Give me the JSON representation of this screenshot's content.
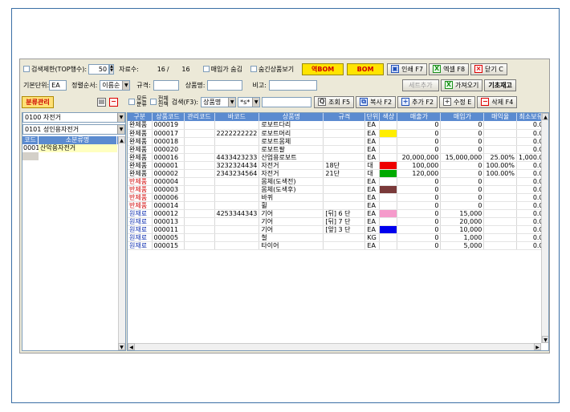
{
  "toolbar1": {
    "search_limit_label": "검색제한(TOP행수):",
    "search_limit_value": "50",
    "record_label": "자료수:",
    "record_current": "16",
    "record_sep": "/",
    "record_total": "16",
    "hide_buy_price_label": "매입가 숨김",
    "show_hidden_label": "숨긴상품보기",
    "reverse_bom_label": "역BOM",
    "bom_label": "BOM",
    "print_label": "인쇄 F7",
    "excel_label": "엑셀 F8",
    "close_label": "닫기 C"
  },
  "toolbar2": {
    "base_unit_label": "기본단위:",
    "base_unit_value": "EA",
    "sort_label": "정렬순서:",
    "sort_value": "이름순",
    "spec_label": "규격:",
    "product_name_label": "상품명:",
    "note_label": "비고:",
    "set_add_label": "세트추가",
    "import_label": "가져오기",
    "base_stock_label": "기초재고"
  },
  "toolbar3": {
    "category_mgmt_label": "분류관리",
    "all_category_label_1": "모든",
    "all_category_label_2": "분류",
    "all_period_label_1": "전체",
    "all_period_label_2": "전책",
    "search_label": "검색(F3):",
    "search_field_value": "상품명",
    "search_op_value": "*s*",
    "query_label": "조회 F5",
    "copy_label": "복사 F2",
    "add_label": "추가 F2",
    "edit_label": "수정 E",
    "delete_label": "삭제 F4"
  },
  "left": {
    "combo1": "0100 자전거",
    "combo2": "0101 성인용자전거",
    "col_code": "코드",
    "col_subcat": "소분류명",
    "rows": [
      {
        "code": "0001",
        "name": "산악용자전거"
      }
    ]
  },
  "grid": {
    "columns": [
      "구분",
      "상품코드",
      "관리코드",
      "바코드",
      "상품명",
      "규격",
      "단위",
      "색상",
      "매출가",
      "매입가",
      "매익율",
      "최소보유"
    ],
    "rows": [
      {
        "type": "완제품",
        "code": "000019",
        "mgmt": "",
        "barcode": "",
        "name": "로보트다리",
        "spec": "",
        "unit": "EA",
        "color": "",
        "sale": "0",
        "buy": "0",
        "margin": "",
        "min": "0.0"
      },
      {
        "type": "완제품",
        "code": "000017",
        "mgmt": "",
        "barcode": "2222222222",
        "name": "로보트머리",
        "spec": "",
        "unit": "EA",
        "color": "#ffee00",
        "sale": "0",
        "buy": "0",
        "margin": "",
        "min": "0.0"
      },
      {
        "type": "완제품",
        "code": "000018",
        "mgmt": "",
        "barcode": "",
        "name": "로보트몸체",
        "spec": "",
        "unit": "EA",
        "color": "",
        "sale": "0",
        "buy": "0",
        "margin": "",
        "min": "0.0"
      },
      {
        "type": "완제품",
        "code": "000020",
        "mgmt": "",
        "barcode": "",
        "name": "로보트팔",
        "spec": "",
        "unit": "EA",
        "color": "",
        "sale": "0",
        "buy": "0",
        "margin": "",
        "min": "0.0"
      },
      {
        "type": "완제품",
        "code": "000016",
        "mgmt": "",
        "barcode": "4433423233",
        "name": "산업용로보트",
        "spec": "",
        "unit": "EA",
        "color": "",
        "sale": "20,000,000",
        "buy": "15,000,000",
        "margin": "25.00%",
        "min": "1,000.0"
      },
      {
        "type": "완제품",
        "code": "000001",
        "mgmt": "",
        "barcode": "3232324434",
        "name": "자전거",
        "spec": "18단",
        "unit": "대",
        "color": "#ee0000",
        "sale": "100,000",
        "buy": "0",
        "margin": "100.00%",
        "min": "0.0"
      },
      {
        "type": "완제품",
        "code": "000002",
        "mgmt": "",
        "barcode": "2343234564",
        "name": "자전거",
        "spec": "21단",
        "unit": "대",
        "color": "#00aa00",
        "sale": "120,000",
        "buy": "0",
        "margin": "100.00%",
        "min": "0.0"
      },
      {
        "type": "반제품",
        "code": "000004",
        "mgmt": "",
        "barcode": "",
        "name": "몸체(도색전)",
        "spec": "",
        "unit": "EA",
        "color": "",
        "sale": "0",
        "buy": "0",
        "margin": "",
        "min": "0.0"
      },
      {
        "type": "반제품",
        "code": "000003",
        "mgmt": "",
        "barcode": "",
        "name": "몸체(도색후)",
        "spec": "",
        "unit": "EA",
        "color": "#7a3a3a",
        "sale": "0",
        "buy": "0",
        "margin": "",
        "min": "0.0"
      },
      {
        "type": "반제품",
        "code": "000006",
        "mgmt": "",
        "barcode": "",
        "name": "바퀴",
        "spec": "",
        "unit": "EA",
        "color": "",
        "sale": "0",
        "buy": "0",
        "margin": "",
        "min": "0.0"
      },
      {
        "type": "반제품",
        "code": "000014",
        "mgmt": "",
        "barcode": "",
        "name": "휠",
        "spec": "",
        "unit": "EA",
        "color": "",
        "sale": "0",
        "buy": "0",
        "margin": "",
        "min": "0.0"
      },
      {
        "type": "원재료",
        "code": "000012",
        "mgmt": "",
        "barcode": "4253344343",
        "name": "기어",
        "spec": "[뒤] 6 단",
        "unit": "EA",
        "color": "#f59acb",
        "sale": "0",
        "buy": "15,000",
        "margin": "",
        "min": "0.0"
      },
      {
        "type": "원재료",
        "code": "000013",
        "mgmt": "",
        "barcode": "",
        "name": "기어",
        "spec": "[뒤] 7 단",
        "unit": "EA",
        "color": "",
        "sale": "0",
        "buy": "20,000",
        "margin": "",
        "min": "0.0"
      },
      {
        "type": "원재료",
        "code": "000011",
        "mgmt": "",
        "barcode": "",
        "name": "기어",
        "spec": "[앞] 3 단",
        "unit": "EA",
        "color": "#0000ee",
        "sale": "0",
        "buy": "10,000",
        "margin": "",
        "min": "0.0"
      },
      {
        "type": "원재료",
        "code": "000005",
        "mgmt": "",
        "barcode": "",
        "name": "철",
        "spec": "",
        "unit": "KG",
        "color": "",
        "sale": "0",
        "buy": "1,000",
        "margin": "",
        "min": "0.0"
      },
      {
        "type": "원재료",
        "code": "000015",
        "mgmt": "",
        "barcode": "",
        "name": "타이어",
        "spec": "",
        "unit": "EA",
        "color": "",
        "sale": "0",
        "buy": "5,000",
        "margin": "",
        "min": "0.0"
      }
    ],
    "type_colors": {
      "완제품": "#000000",
      "반제품": "#d00000",
      "원재료": "#1030b0"
    }
  }
}
